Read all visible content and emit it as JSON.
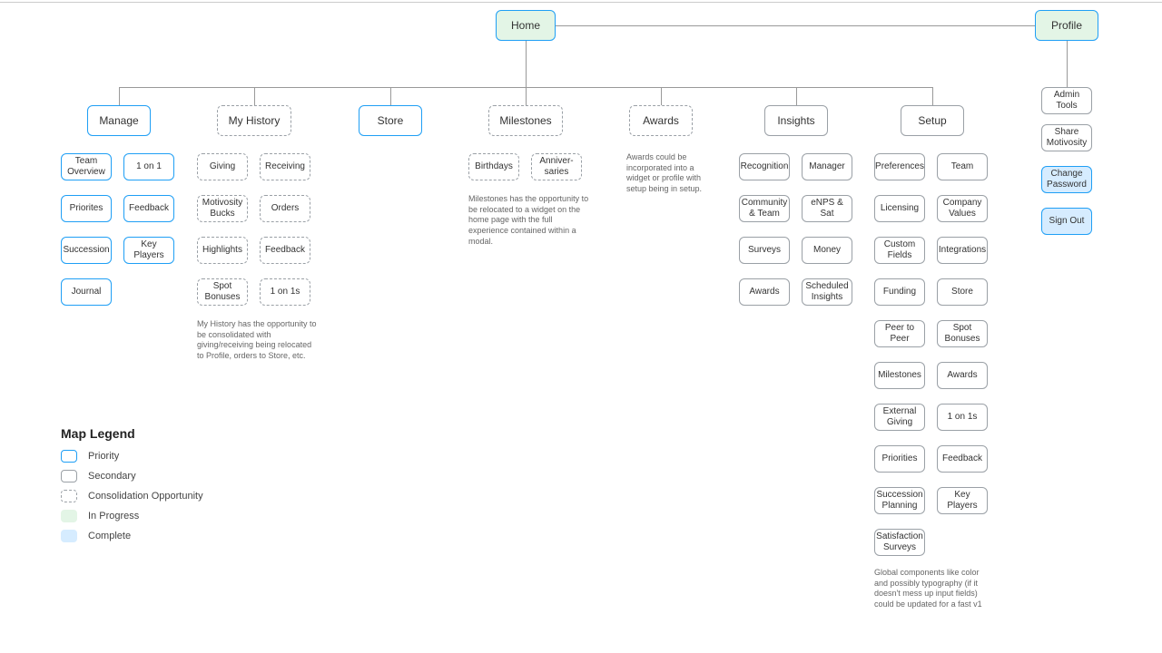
{
  "root": {
    "home": "Home",
    "profile": "Profile"
  },
  "sections": {
    "manage": "Manage",
    "myhistory": "My History",
    "store": "Store",
    "milestones": "Milestones",
    "awards": "Awards",
    "insights": "Insights",
    "setup": "Setup"
  },
  "manage": {
    "team_overview": "Team Overview",
    "one_on_one": "1 on 1",
    "priorities": "Priorites",
    "feedback": "Feedback",
    "succession": "Succession",
    "key_players": "Key Players",
    "journal": "Journal"
  },
  "myhistory": {
    "giving": "Giving",
    "receiving": "Receiving",
    "motivosity_bucks": "Motivosity Bucks",
    "orders": "Orders",
    "highlights": "Highlights",
    "feedback": "Feedback",
    "spot_bonuses": "Spot Bonuses",
    "one_on_1s": "1 on 1s",
    "note": "My History has the opportunity to be consolidated with giving/receiving being relocated to Profile, orders to Store, etc."
  },
  "milestones": {
    "birthdays": "Birthdays",
    "anniversaries": "Anniver-saries",
    "note": "Milestones has the opportunity to be relocated to a widget on the home page with the full experience contained within a modal."
  },
  "awards_note": "Awards could be incorporated into a widget or profile with setup being in setup.",
  "insights": {
    "recognition": "Recognition",
    "manager": "Manager",
    "community_team": "Community & Team",
    "enps_sat": "eNPS & Sat",
    "surveys": "Surveys",
    "money": "Money",
    "awards": "Awards",
    "scheduled_insights": "Scheduled Insights"
  },
  "setup": {
    "preferences": "Preferences",
    "team": "Team",
    "licensing": "Licensing",
    "company_values": "Company Values",
    "custom_fields": "Custom Fields",
    "integrations": "Integrations",
    "funding": "Funding",
    "store": "Store",
    "peer_to_peer": "Peer to Peer",
    "spot_bonuses": "Spot Bonuses",
    "milestones": "Milestones",
    "awards": "Awards",
    "external_giving": "External Giving",
    "one_on_1s": "1 on 1s",
    "priorities": "Priorities",
    "feedback": "Feedback",
    "succession_planning": "Succession Planning",
    "key_players": "Key Players",
    "satisfaction_surveys": "Satisfaction Surveys",
    "note": "Global components like color and possibly typography (if it doesn't mess up input fields) could be updated for a fast v1"
  },
  "profile": {
    "admin_tools": "Admin Tools",
    "share_motivosity": "Share Motivosity",
    "change_password": "Change Password",
    "sign_out": "Sign Out"
  },
  "legend": {
    "title": "Map Legend",
    "priority": "Priority",
    "secondary": "Secondary",
    "consolidate": "Consolidation Opportunity",
    "inprogress": "In Progress",
    "complete": "Complete"
  }
}
